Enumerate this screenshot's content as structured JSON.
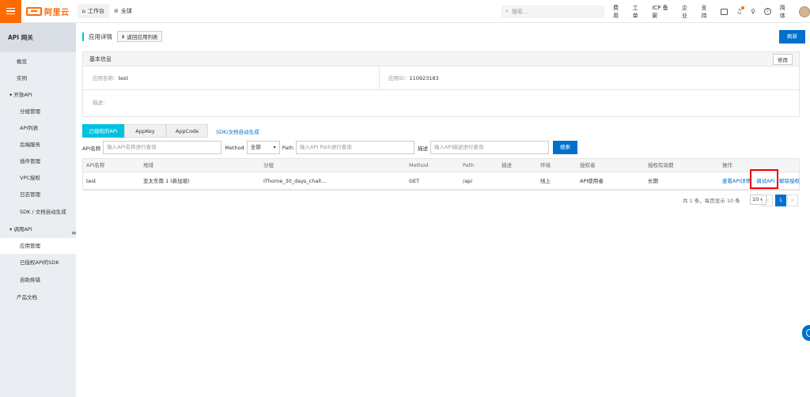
{
  "topbar": {
    "brand": "阿里云",
    "workbench": "工作台",
    "region": "全球",
    "search_placeholder": "搜索...",
    "links": [
      "费用",
      "工单",
      "ICP 备案",
      "企业",
      "支持"
    ],
    "lang": "简体"
  },
  "sidebar": {
    "title": "API 网关",
    "items": [
      {
        "label": "概览"
      },
      {
        "label": "实例"
      },
      {
        "label": "开放API"
      },
      {
        "label": "分组管理"
      },
      {
        "label": "API列表"
      },
      {
        "label": "后端服务"
      },
      {
        "label": "插件管理"
      },
      {
        "label": "VPC授权"
      },
      {
        "label": "日志管理"
      },
      {
        "label": "SDK / 文档自动生成"
      },
      {
        "label": "调用API"
      },
      {
        "label": "应用管理"
      },
      {
        "label": "已授权API的SDK"
      },
      {
        "label": "自助排错"
      },
      {
        "label": "产品文档"
      }
    ]
  },
  "page": {
    "title": "应用详情",
    "back_label": "返回应用列表",
    "refresh_label": "刷新"
  },
  "basic_info": {
    "title": "基本信息",
    "edit_label": "修改",
    "app_name_label": "应用名称：",
    "app_name": "test",
    "app_id_label": "应用ID：",
    "app_id": "110923183",
    "desc_label": "描述："
  },
  "tabs": {
    "items": [
      "已授权的API",
      "AppKey",
      "AppCode"
    ],
    "sdk_link": "SDK/文档自动生成"
  },
  "filter": {
    "api_name_label": "API名称",
    "api_name_placeholder": "输入API名称进行查询",
    "method_label": "Method",
    "method_value": "全部",
    "path_label": "Path",
    "path_placeholder": "输入API Path进行查询",
    "desc_label": "描述",
    "desc_placeholder": "输入API描述进行查询",
    "search_label": "搜索"
  },
  "table": {
    "headers": [
      "API名称",
      "地域",
      "分组",
      "Method",
      "Path",
      "描述",
      "环境",
      "授权者",
      "授权有效期",
      "操作"
    ],
    "row": {
      "name": "test",
      "region": "亚太东南 1 (新加坡)",
      "group": "IThome_30_days_chall...",
      "method": "GET",
      "path": "/api",
      "desc": "",
      "env": "线上",
      "grantor": "API使用者",
      "validity": "长期",
      "ops": [
        "查看API详情",
        "调试API",
        "解除授权"
      ]
    }
  },
  "pager": {
    "summary": "共 1 条，每页显示 10 条",
    "page_size": "10",
    "prev": "<",
    "current": "1",
    "next": ">"
  }
}
